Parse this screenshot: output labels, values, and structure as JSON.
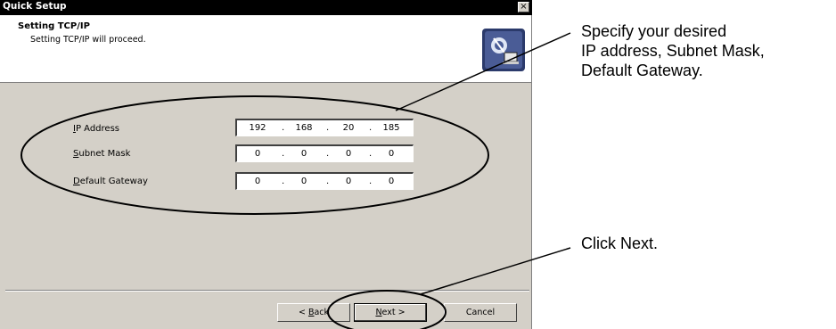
{
  "window": {
    "title": "Quick Setup",
    "close_glyph": "×"
  },
  "header": {
    "title": "Setting TCP/IP",
    "subtitle": "Setting TCP/IP will proceed.",
    "icon": "network-setup-icon"
  },
  "fields": [
    {
      "mnemonic": "I",
      "rest": "P Address",
      "octets": [
        "192",
        "168",
        "20",
        "185"
      ]
    },
    {
      "mnemonic": "S",
      "rest": "ubnet Mask",
      "octets": [
        "0",
        "0",
        "0",
        "0"
      ]
    },
    {
      "mnemonic": "D",
      "rest": "efault Gateway",
      "octets": [
        "0",
        "0",
        "0",
        "0"
      ]
    }
  ],
  "buttons": {
    "back_prefix": "< ",
    "back_mnemonic": "B",
    "back_rest": "ack",
    "next_mnemonic": "N",
    "next_rest": "ext >",
    "cancel": "Cancel"
  },
  "annotations": {
    "callout1_line1": "Specify your desired",
    "callout1_line2": "IP address, Subnet Mask,",
    "callout1_line3": "Default Gateway.",
    "callout2": "Click Next."
  }
}
